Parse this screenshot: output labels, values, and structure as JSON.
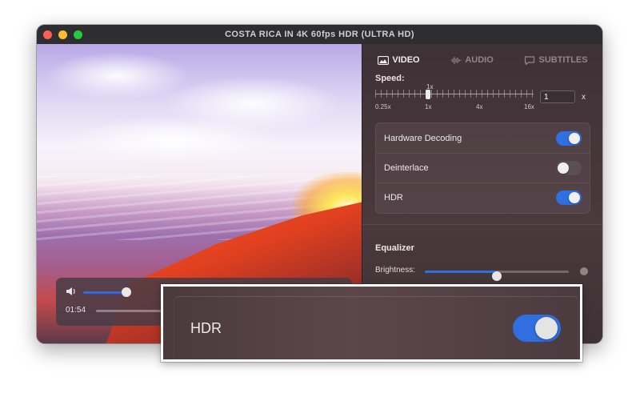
{
  "window": {
    "title": "COSTA RICA IN 4K 60fps HDR (ULTRA HD)"
  },
  "tabs": [
    {
      "label": "VIDEO",
      "icon": "image-icon",
      "active": true
    },
    {
      "label": "AUDIO",
      "icon": "waveform-icon",
      "active": false
    },
    {
      "label": "SUBTITLES",
      "icon": "speech-bubble-icon",
      "active": false
    }
  ],
  "player": {
    "time": "01:54",
    "volume_level": 0.85
  },
  "speed": {
    "label": "Speed:",
    "top_tick_label": "1x",
    "scale_labels": [
      "0.25x",
      "1x",
      "4x",
      "16x"
    ],
    "value": "1",
    "unit": "x"
  },
  "toggles": [
    {
      "label": "Hardware Decoding",
      "on": true
    },
    {
      "label": "Deinterlace",
      "on": false
    },
    {
      "label": "HDR",
      "on": true
    }
  ],
  "equalizer": {
    "title": "Equalizer",
    "rows": [
      {
        "label": "Brightness:",
        "value": 0.5
      }
    ]
  },
  "zoom_callout": {
    "label": "HDR",
    "on": true
  },
  "colors": {
    "accent": "#2f6fe0",
    "panel": "#3e3236"
  }
}
